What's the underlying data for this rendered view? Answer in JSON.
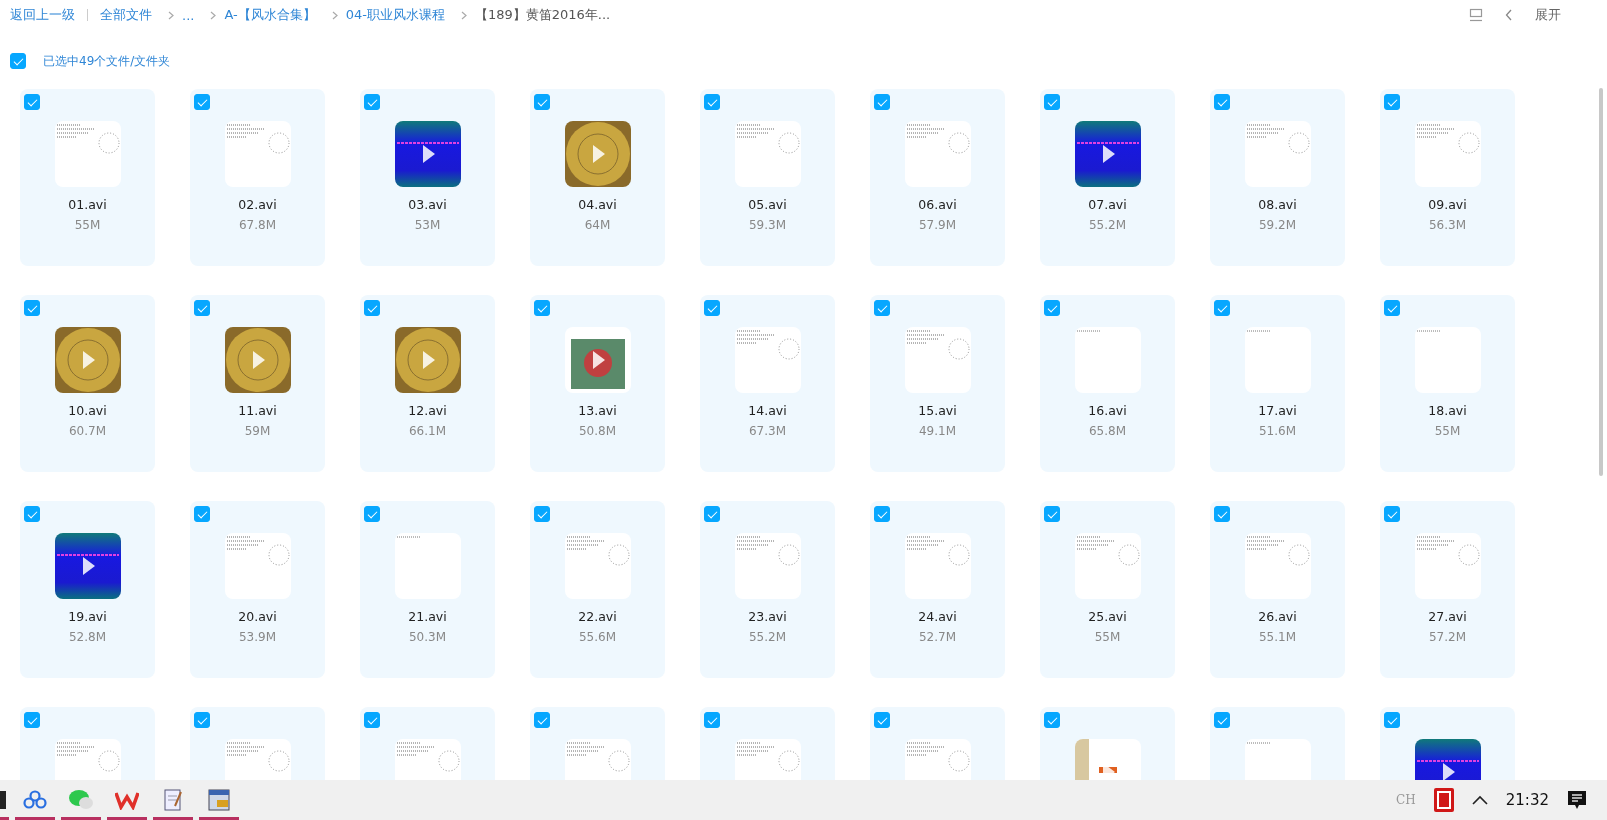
{
  "toolbar": {
    "back": "返回上一级",
    "breadcrumbs": [
      {
        "label": "全部文件",
        "current": false
      },
      {
        "label": "...",
        "current": false
      },
      {
        "label": "A-【风水合集】",
        "current": false
      },
      {
        "label": "04-职业风水课程",
        "current": false
      },
      {
        "label": "【189】黄笛2016年...",
        "current": true
      }
    ],
    "expand": "展开"
  },
  "selection": {
    "checked": true,
    "label": "已选中49个文件/文件夹"
  },
  "files": [
    {
      "name": "01.avi",
      "size": "55M",
      "checked": true,
      "kind": "doc"
    },
    {
      "name": "02.avi",
      "size": "67.8M",
      "checked": true,
      "kind": "doc"
    },
    {
      "name": "03.avi",
      "size": "53M",
      "checked": true,
      "kind": "blue"
    },
    {
      "name": "04.avi",
      "size": "64M",
      "checked": true,
      "kind": "gold"
    },
    {
      "name": "05.avi",
      "size": "59.3M",
      "checked": true,
      "kind": "doc"
    },
    {
      "name": "06.avi",
      "size": "57.9M",
      "checked": true,
      "kind": "doc"
    },
    {
      "name": "07.avi",
      "size": "55.2M",
      "checked": true,
      "kind": "blue"
    },
    {
      "name": "08.avi",
      "size": "59.2M",
      "checked": true,
      "kind": "doc"
    },
    {
      "name": "09.avi",
      "size": "56.3M",
      "checked": true,
      "kind": "doc"
    },
    {
      "name": "10.avi",
      "size": "60.7M",
      "checked": true,
      "kind": "gold"
    },
    {
      "name": "11.avi",
      "size": "59M",
      "checked": true,
      "kind": "gold"
    },
    {
      "name": "12.avi",
      "size": "66.1M",
      "checked": true,
      "kind": "gold"
    },
    {
      "name": "13.avi",
      "size": "50.8M",
      "checked": true,
      "kind": "dragon"
    },
    {
      "name": "14.avi",
      "size": "67.3M",
      "checked": true,
      "kind": "doc"
    },
    {
      "name": "15.avi",
      "size": "49.1M",
      "checked": true,
      "kind": "doc"
    },
    {
      "name": "16.avi",
      "size": "65.8M",
      "checked": true,
      "kind": "blank"
    },
    {
      "name": "17.avi",
      "size": "51.6M",
      "checked": true,
      "kind": "blank"
    },
    {
      "name": "18.avi",
      "size": "55M",
      "checked": true,
      "kind": "blank"
    },
    {
      "name": "19.avi",
      "size": "52.8M",
      "checked": true,
      "kind": "blue"
    },
    {
      "name": "20.avi",
      "size": "53.9M",
      "checked": true,
      "kind": "doc"
    },
    {
      "name": "21.avi",
      "size": "50.3M",
      "checked": true,
      "kind": "blank"
    },
    {
      "name": "22.avi",
      "size": "55.6M",
      "checked": true,
      "kind": "doc"
    },
    {
      "name": "23.avi",
      "size": "55.2M",
      "checked": true,
      "kind": "doc"
    },
    {
      "name": "24.avi",
      "size": "52.7M",
      "checked": true,
      "kind": "doc"
    },
    {
      "name": "25.avi",
      "size": "55M",
      "checked": true,
      "kind": "doc"
    },
    {
      "name": "26.avi",
      "size": "55.1M",
      "checked": true,
      "kind": "doc"
    },
    {
      "name": "27.avi",
      "size": "57.2M",
      "checked": true,
      "kind": "doc"
    },
    {
      "checked": true,
      "kind": "doc"
    },
    {
      "checked": true,
      "kind": "doc"
    },
    {
      "checked": true,
      "kind": "doc"
    },
    {
      "checked": true,
      "kind": "doc"
    },
    {
      "checked": true,
      "kind": "doc"
    },
    {
      "checked": true,
      "kind": "doc"
    },
    {
      "checked": true,
      "kind": "screenshot"
    },
    {
      "checked": true,
      "kind": "blank"
    },
    {
      "checked": true,
      "kind": "blue"
    }
  ],
  "taskbar": {
    "apps": [
      {
        "kind": "dark",
        "running": true
      },
      {
        "kind": "cloud",
        "running": true
      },
      {
        "kind": "chat",
        "running": true
      },
      {
        "kind": "office",
        "running": true
      },
      {
        "kind": "notepad",
        "running": true
      },
      {
        "kind": "window",
        "running": true
      }
    ],
    "ime": "CH",
    "time": "21:32"
  }
}
